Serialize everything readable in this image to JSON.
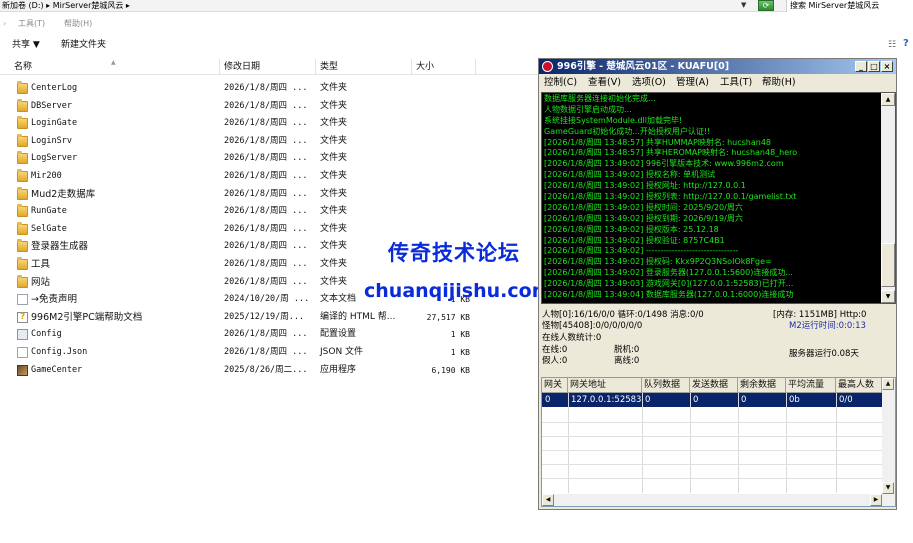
{
  "address_bar": {
    "path": "新加卷 (D:) ▸ MirServer楚城风云 ▸",
    "search_placeholder": "搜索 MirServer楚城风云"
  },
  "menubar": {
    "tools": "工具(T)",
    "help": "帮助(H)"
  },
  "toolbar": {
    "share": "共享 ▼",
    "new_folder": "新建文件夹"
  },
  "columns": {
    "name": "名称",
    "date": "修改日期",
    "type": "类型",
    "size": "大小"
  },
  "files": [
    {
      "name": "CenterLog",
      "date": "2026/1/8/周四 ...",
      "type": "文件夹",
      "size": "",
      "icon": "folder-icon"
    },
    {
      "name": "DBServer",
      "date": "2026/1/8/周四 ...",
      "type": "文件夹",
      "size": "",
      "icon": "folder-icon"
    },
    {
      "name": "LoginGate",
      "date": "2026/1/8/周四 ...",
      "type": "文件夹",
      "size": "",
      "icon": "folder-icon"
    },
    {
      "name": "LoginSrv",
      "date": "2026/1/8/周四 ...",
      "type": "文件夹",
      "size": "",
      "icon": "folder-icon"
    },
    {
      "name": "LogServer",
      "date": "2026/1/8/周四 ...",
      "type": "文件夹",
      "size": "",
      "icon": "folder-icon"
    },
    {
      "name": "Mir200",
      "date": "2026/1/8/周四 ...",
      "type": "文件夹",
      "size": "",
      "icon": "folder-icon"
    },
    {
      "name": "Mud2走数据库",
      "date": "2026/1/8/周四 ...",
      "type": "文件夹",
      "size": "",
      "icon": "folder-icon"
    },
    {
      "name": "RunGate",
      "date": "2026/1/8/周四 ...",
      "type": "文件夹",
      "size": "",
      "icon": "folder-icon"
    },
    {
      "name": "SelGate",
      "date": "2026/1/8/周四 ...",
      "type": "文件夹",
      "size": "",
      "icon": "folder-icon"
    },
    {
      "name": "登录器生成器",
      "date": "2026/1/8/周四 ...",
      "type": "文件夹",
      "size": "",
      "icon": "folder-icon"
    },
    {
      "name": "工具",
      "date": "2026/1/8/周四 ...",
      "type": "文件夹",
      "size": "",
      "icon": "folder-icon"
    },
    {
      "name": "网站",
      "date": "2026/1/8/周四 ...",
      "type": "文件夹",
      "size": "",
      "icon": "folder-icon"
    },
    {
      "name": "→免责声明",
      "date": "2024/10/20/周 ...",
      "type": "文本文档",
      "size": "1 KB",
      "icon": "text-document-icon"
    },
    {
      "name": "996M2引擎PC端帮助文档",
      "date": "2025/12/19/周...",
      "type": "编译的 HTML 帮...",
      "size": "27,517 KB",
      "icon": "html-help-icon"
    },
    {
      "name": "Config",
      "date": "2026/1/8/周四 ...",
      "type": "配置设置",
      "size": "1 KB",
      "icon": "config-file-icon"
    },
    {
      "name": "Config.Json",
      "date": "2026/1/8/周四 ...",
      "type": "JSON 文件",
      "size": "1 KB",
      "icon": "json-file-icon"
    },
    {
      "name": "GameCenter",
      "date": "2025/8/26/周二...",
      "type": "应用程序",
      "size": "6,190 KB",
      "icon": "app-icon"
    }
  ],
  "watermark": {
    "line1": "传奇技术论坛",
    "line2": "chuanqijishu.com"
  },
  "engine": {
    "title": "996引擎 - 楚城风云01区 - KUAFU[0]",
    "menu": [
      "控制(C)",
      "查看(V)",
      "选项(O)",
      "管理(A)",
      "工具(T)",
      "帮助(H)"
    ],
    "console": [
      "数据库服务器连接初始化完成...",
      "人物数据引擎启动成功...",
      "系统挂接SystemModule.dll加载完毕!",
      "GameGuard初始化成功...开始授权用户认证!!",
      "[2026/1/8/周四 13:48:57] 共享HUMMAP映射名: hucshan48",
      "[2026/1/8/周四 13:48:57] 共享HEROMAP映射名: hucshan48_hero",
      "[2026/1/8/周四 13:49:02] 996引擎版本技术: www.996m2.com",
      "[2026/1/8/周四 13:49:02] 授权名称: 单机测试",
      "[2026/1/8/周四 13:49:02] 授权网址: http://127.0.0.1",
      "[2026/1/8/周四 13:49:02] 授权列表: http://127.0.0.1/gamelist.txt",
      "[2026/1/8/周四 13:49:02] 授权时间: 2025/9/20/周六",
      "[2026/1/8/周四 13:49:02] 授权到期: 2026/9/19/周六",
      "[2026/1/8/周四 13:49:02] 授权版本: 25.12.18",
      "[2026/1/8/周四 13:49:02] 授权验证: 8757C4B1",
      "[2026/1/8/周四 13:49:02] --------------------------------",
      "[2026/1/8/周四 13:49:02] 授权码: Kkx9P2Q3NSoIOk8Fge=",
      "[2026/1/8/周四 13:49:02] 登录服务器(127.0.0.1:5600)连接成功...",
      "[2026/1/8/周四 13:49:03] 游戏网关[0](127.0.0.1:52583)已打开...",
      "[2026/1/8/周四 13:49:04] 数据库服务器(127.0.0.1:6000)连接成功"
    ],
    "stats": {
      "people": "人物[0]:16/16/0/0 循环:0/1498 消息:0/0",
      "memory": "[内存: 1151MB] Http:0",
      "monsters": "怪物[45408]:0/0/0/0/0/0",
      "m2_runtime": "M2运行时间:0:0:13",
      "online_stat": "在线人数统计:0",
      "online": "在线:0",
      "offline_hang": "脱机:0",
      "fake": "假人:0",
      "disconnect_hang": "离线:0",
      "server_run": "服务器运行0.08天"
    },
    "grid": {
      "headers": [
        "网关",
        "网关地址",
        "队列数据",
        "发送数据",
        "剩余数据",
        "平均流量",
        "最高人数"
      ],
      "rows": [
        [
          "0",
          "127.0.0.1:52583",
          "0",
          "0",
          "0",
          "0b",
          "0/0"
        ]
      ]
    }
  }
}
